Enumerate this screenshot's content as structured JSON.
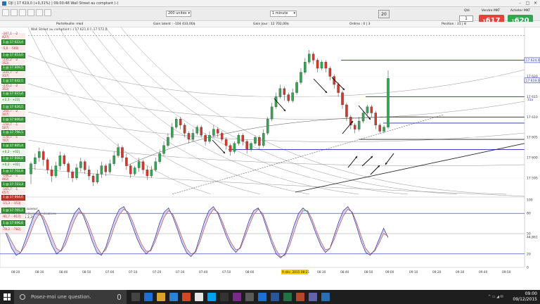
{
  "window": {
    "title": "DJI | 17 619,0 (+0,31%) | 09:00:48 Wall Street au comptant (-)"
  },
  "toolbar": {
    "period_select": "200 unités",
    "interval_select": "1 minute",
    "badge": "20",
    "qty_label": "Qté",
    "qty_value": "1",
    "sell_label": "Vendre MKT",
    "sell_price": "617",
    "sell_price_prefix": "1",
    "buy_label": "Acheter MKT",
    "buy_price": "620",
    "buy_price_prefix": "1",
    "sell_color": "#e0443a",
    "buy_color": "#2fa84f"
  },
  "infobar": {
    "portfolio": "Portefeuille: mkd",
    "latent": "Gain latent : -104 433,00$",
    "day": "Gain Jour : 12 702,00$",
    "orders": "Ordres : 0 | 3",
    "position": "Position : 31 | 8"
  },
  "chart_data": {
    "type": "candlestick",
    "instrument": "DJI",
    "legend": "Wall Street au comptant (-) 17 621,0 / -17 572,0",
    "y_ticks": [
      "17 620",
      "17 615",
      "17 610",
      "17 605",
      "17 600",
      "17 595"
    ],
    "y_tick_values": [
      17620,
      17615,
      17610,
      17605,
      17600,
      17595
    ],
    "x_ticks": [
      "08:20",
      "08:30",
      "08:40",
      "08:50",
      "07:00",
      "07:10",
      "07:20",
      "07:30",
      "07:40",
      "07:50",
      "08:00",
      "08:10",
      "9 déc. 2015 08:21",
      "08:30",
      "08:40",
      "08:50",
      "09:00",
      "09:10",
      "09:20",
      "09:30",
      "09:40",
      "09:50"
    ],
    "highlighted_tick": "9 déc. 2015 08:21",
    "candles": [
      [
        17596,
        17598.5,
        17593.5,
        17599
      ],
      [
        17598.5,
        17600,
        17597,
        17601
      ],
      [
        17600,
        17601.5,
        17599,
        17602.5
      ],
      [
        17601.5,
        17599.5,
        17598,
        17602
      ],
      [
        17599.5,
        17597,
        17596,
        17600
      ],
      [
        17597,
        17595.5,
        17594,
        17598
      ],
      [
        17595.5,
        17598,
        17595,
        17599
      ],
      [
        17598,
        17600.5,
        17597,
        17601.5
      ],
      [
        17600.5,
        17598.5,
        17598,
        17601
      ],
      [
        17598.5,
        17596.5,
        17595,
        17599
      ],
      [
        17596.5,
        17595,
        17594,
        17597
      ],
      [
        17595,
        17597.5,
        17594.5,
        17598.5
      ],
      [
        17597.5,
        17599,
        17596.5,
        17600
      ],
      [
        17599,
        17597,
        17596,
        17599.5
      ],
      [
        17597,
        17595.5,
        17594.5,
        17598
      ],
      [
        17595.5,
        17594,
        17593,
        17596
      ],
      [
        17594,
        17596,
        17593.5,
        17597
      ],
      [
        17596,
        17598,
        17595,
        17599
      ],
      [
        17598,
        17596.5,
        17595.5,
        17598.5
      ],
      [
        17596.5,
        17598.5,
        17596,
        17599.5
      ],
      [
        17598.5,
        17600.5,
        17598,
        17601.5
      ],
      [
        17600.5,
        17602.5,
        17600,
        17603.5
      ],
      [
        17602.5,
        17600,
        17599,
        17603
      ],
      [
        17600,
        17598,
        17597,
        17601
      ],
      [
        17598,
        17596,
        17595,
        17598.5
      ],
      [
        17596,
        17597.5,
        17595.5,
        17598
      ],
      [
        17597.5,
        17599,
        17596.5,
        17600
      ],
      [
        17599,
        17597,
        17596,
        17599.5
      ],
      [
        17597,
        17595.5,
        17594.5,
        17598
      ],
      [
        17595.5,
        17597,
        17595,
        17598
      ],
      [
        17597,
        17599,
        17596.5,
        17600
      ],
      [
        17599,
        17601,
        17598.5,
        17602
      ],
      [
        17601,
        17603,
        17600.5,
        17604
      ],
      [
        17603,
        17605,
        17602.5,
        17606
      ],
      [
        17605,
        17607.5,
        17604.5,
        17608.5
      ],
      [
        17607.5,
        17609.5,
        17607,
        17610
      ],
      [
        17609.5,
        17608,
        17607,
        17610
      ],
      [
        17608,
        17606,
        17605,
        17608.5
      ],
      [
        17606,
        17604.5,
        17603.5,
        17606.5
      ],
      [
        17604.5,
        17606,
        17604,
        17607
      ],
      [
        17606,
        17607.5,
        17605.5,
        17608
      ],
      [
        17607.5,
        17605.5,
        17605,
        17608
      ],
      [
        17605.5,
        17604,
        17603,
        17606
      ],
      [
        17604,
        17605.5,
        17603.5,
        17606.5
      ],
      [
        17605.5,
        17607,
        17605,
        17608
      ],
      [
        17607,
        17606,
        17605,
        17607.5
      ],
      [
        17606,
        17604.5,
        17604,
        17606.5
      ],
      [
        17604.5,
        17603,
        17602,
        17605
      ],
      [
        17603,
        17601.5,
        17600.5,
        17603.5
      ],
      [
        17601.5,
        17603.5,
        17601,
        17604
      ],
      [
        17603.5,
        17605.5,
        17603,
        17606
      ],
      [
        17605.5,
        17604,
        17603,
        17606
      ],
      [
        17604,
        17602,
        17601,
        17604.5
      ],
      [
        17602,
        17603.5,
        17601.5,
        17604
      ],
      [
        17603.5,
        17605,
        17603,
        17605.5
      ],
      [
        17605,
        17603,
        17602,
        17605.5
      ],
      [
        17603,
        17606,
        17602.5,
        17607
      ],
      [
        17606,
        17609.5,
        17605.5,
        17610
      ],
      [
        17609.5,
        17612.5,
        17609,
        17613.5
      ],
      [
        17612.5,
        17615,
        17612,
        17616
      ],
      [
        17615,
        17617,
        17614.5,
        17618
      ],
      [
        17617,
        17615.5,
        17614,
        17617.5
      ],
      [
        17615.5,
        17614,
        17613.5,
        17616
      ],
      [
        17614,
        17616,
        17613.5,
        17617
      ],
      [
        17616,
        17618.5,
        17615.5,
        17619
      ],
      [
        17618.5,
        17621,
        17618,
        17622
      ],
      [
        17621,
        17623.5,
        17620.5,
        17624.5
      ],
      [
        17623.5,
        17625.5,
        17623,
        17626.5
      ],
      [
        17625.5,
        17624,
        17623,
        17626
      ],
      [
        17624,
        17622,
        17621,
        17624.5
      ],
      [
        17622,
        17623.5,
        17621.5,
        17624
      ],
      [
        17623.5,
        17622,
        17621,
        17624
      ],
      [
        17622,
        17620,
        17619,
        17622.5
      ],
      [
        17620,
        17618,
        17617,
        17620.5
      ],
      [
        17618,
        17616,
        17615,
        17618.5
      ],
      [
        17616,
        17613,
        17612,
        17616.5
      ],
      [
        17613,
        17610,
        17609,
        17613.5
      ],
      [
        17610,
        17608,
        17607,
        17610.5
      ],
      [
        17608,
        17607,
        17606,
        17608.5
      ],
      [
        17607,
        17609,
        17606.5,
        17610
      ],
      [
        17609,
        17611,
        17608.5,
        17611.5
      ],
      [
        17611,
        17612.5,
        17610.5,
        17613
      ],
      [
        17612.5,
        17611,
        17610,
        17613
      ],
      [
        17611,
        17608,
        17607,
        17611.5
      ],
      [
        17608,
        17606.5,
        17606,
        17608.5
      ],
      [
        17606.5,
        17607.5,
        17606,
        17608
      ],
      [
        17607.5,
        17619.5,
        17607,
        17621.5
      ]
    ],
    "horizontal_lines": [
      17624,
      17615,
      17610,
      17608.5,
      17604.5,
      17602
    ],
    "price_labels": [
      {
        "price": 17624,
        "text": "17 624,0",
        "color": "#1f2dbf"
      },
      {
        "price": 17619,
        "text": "17 619,0",
        "color": "#1f2dbf"
      }
    ],
    "current_price_side_label": "31a",
    "indicator": {
      "name": "Stochastique (5,3,3)",
      "levels": [
        80,
        50,
        20
      ],
      "y_ticks": [
        "100",
        "80",
        "50",
        "44,861",
        "20",
        "0"
      ],
      "k_values": [
        62,
        45,
        28,
        18,
        22,
        40,
        60,
        78,
        85,
        70,
        50,
        32,
        20,
        25,
        42,
        64,
        80,
        88,
        76,
        58,
        38,
        22,
        18,
        30,
        52,
        72,
        86,
        90,
        78,
        60,
        42,
        28,
        20,
        26,
        44,
        66,
        82,
        88,
        74,
        56,
        36,
        22,
        16,
        24,
        46,
        68,
        84,
        90,
        80,
        62,
        44,
        30,
        22,
        30,
        50,
        70,
        84,
        88,
        76,
        56,
        36,
        20,
        14,
        20,
        40,
        62,
        80,
        88,
        82,
        66,
        48,
        32,
        22,
        28,
        48,
        68,
        84,
        90,
        80,
        60,
        38,
        22,
        18,
        26,
        42,
        58,
        44
      ],
      "d_values": [
        58,
        50,
        38,
        26,
        22,
        32,
        48,
        66,
        78,
        76,
        62,
        44,
        28,
        24,
        34,
        52,
        70,
        82,
        80,
        66,
        48,
        30,
        20,
        26,
        42,
        62,
        78,
        86,
        82,
        68,
        50,
        34,
        24,
        24,
        38,
        56,
        74,
        84,
        78,
        62,
        44,
        28,
        20,
        22,
        38,
        58,
        76,
        86,
        82,
        68,
        50,
        36,
        26,
        28,
        44,
        62,
        78,
        86,
        80,
        62,
        42,
        26,
        16,
        18,
        32,
        52,
        72,
        84,
        84,
        72,
        54,
        38,
        26,
        28,
        42,
        60,
        76,
        86,
        82,
        66,
        46,
        28,
        20,
        24,
        36,
        50,
        46
      ]
    }
  },
  "positions_panel": [
    {
      "kind": "pnl",
      "text": "-247,1 · -2 427|",
      "pos": false
    },
    {
      "kind": "order",
      "text": "1 @ 17 623,4"
    },
    {
      "kind": "pnl",
      "text": "-5,0 · -500|",
      "pos": false
    },
    {
      "kind": "order",
      "text": "1 @ 17 653,0"
    },
    {
      "kind": "pnl",
      "text": "-235,2 · -2 352|",
      "pos": false
    },
    {
      "kind": "order",
      "text": "1 @ 17 609,5"
    },
    {
      "kind": "pnl",
      "text": "-231,7 · -2 317|",
      "pos": false
    },
    {
      "kind": "order",
      "text": "1 @ 17 642,5"
    },
    {
      "kind": "pnl",
      "text": "-235,2 · -2 352|",
      "pos": false
    },
    {
      "kind": "order",
      "text": "1 @ 17 615,4"
    },
    {
      "kind": "pnl",
      "text": "+2,3 · +23|",
      "pos": true
    },
    {
      "kind": "order",
      "text": "1 @ 17 626,5"
    },
    {
      "kind": "pnl",
      "text": "-210,7 · -2 107|",
      "pos": false
    },
    {
      "kind": "order",
      "text": "1 @ 17 606,0"
    },
    {
      "kind": "pnl",
      "text": "-150,7 · -1 507|",
      "pos": false
    },
    {
      "kind": "order",
      "text": "1 @ 17 796,5"
    },
    {
      "kind": "pnl",
      "text": "-170,7 · -1 707|",
      "pos": false
    },
    {
      "kind": "order",
      "text": "1 @ 17 605,4"
    },
    {
      "kind": "pnl",
      "text": "+0,2 · +02|",
      "pos": true
    },
    {
      "kind": "order",
      "text": "1 @ 17 608,8"
    },
    {
      "kind": "pnl",
      "text": "+0,2 · +02|",
      "pos": true
    },
    {
      "kind": "order",
      "text": "1 @ 17 702,8"
    },
    {
      "kind": "pnl",
      "text": "-146,2 · -1 462|",
      "pos": false
    },
    {
      "kind": "order",
      "text": "1 @ 17 723,3"
    },
    {
      "kind": "pnl",
      "text": "-165,7 · -1 657|",
      "pos": false
    },
    {
      "kind": "order",
      "text": "1 @ 17 664,6",
      "red": true
    },
    {
      "kind": "pnl",
      "text": "-15,3 · -153|",
      "pos": false
    },
    {
      "kind": "order",
      "text": "1 @ 17 705,3"
    },
    {
      "kind": "pnl",
      "text": "-91,7 · -917|",
      "pos": false
    },
    {
      "kind": "order",
      "text": "1 @ 17 696,8"
    },
    {
      "kind": "pnl",
      "text": "-78,2 · -782|",
      "pos": false
    }
  ],
  "stop_hint": "Ajouter stop suiveur",
  "footer_note": "© IT-Finance.com  Données indicatives",
  "taskbar": {
    "search_placeholder": "Posez-moi une question.",
    "time": "09:00",
    "date": "09/12/2015"
  }
}
